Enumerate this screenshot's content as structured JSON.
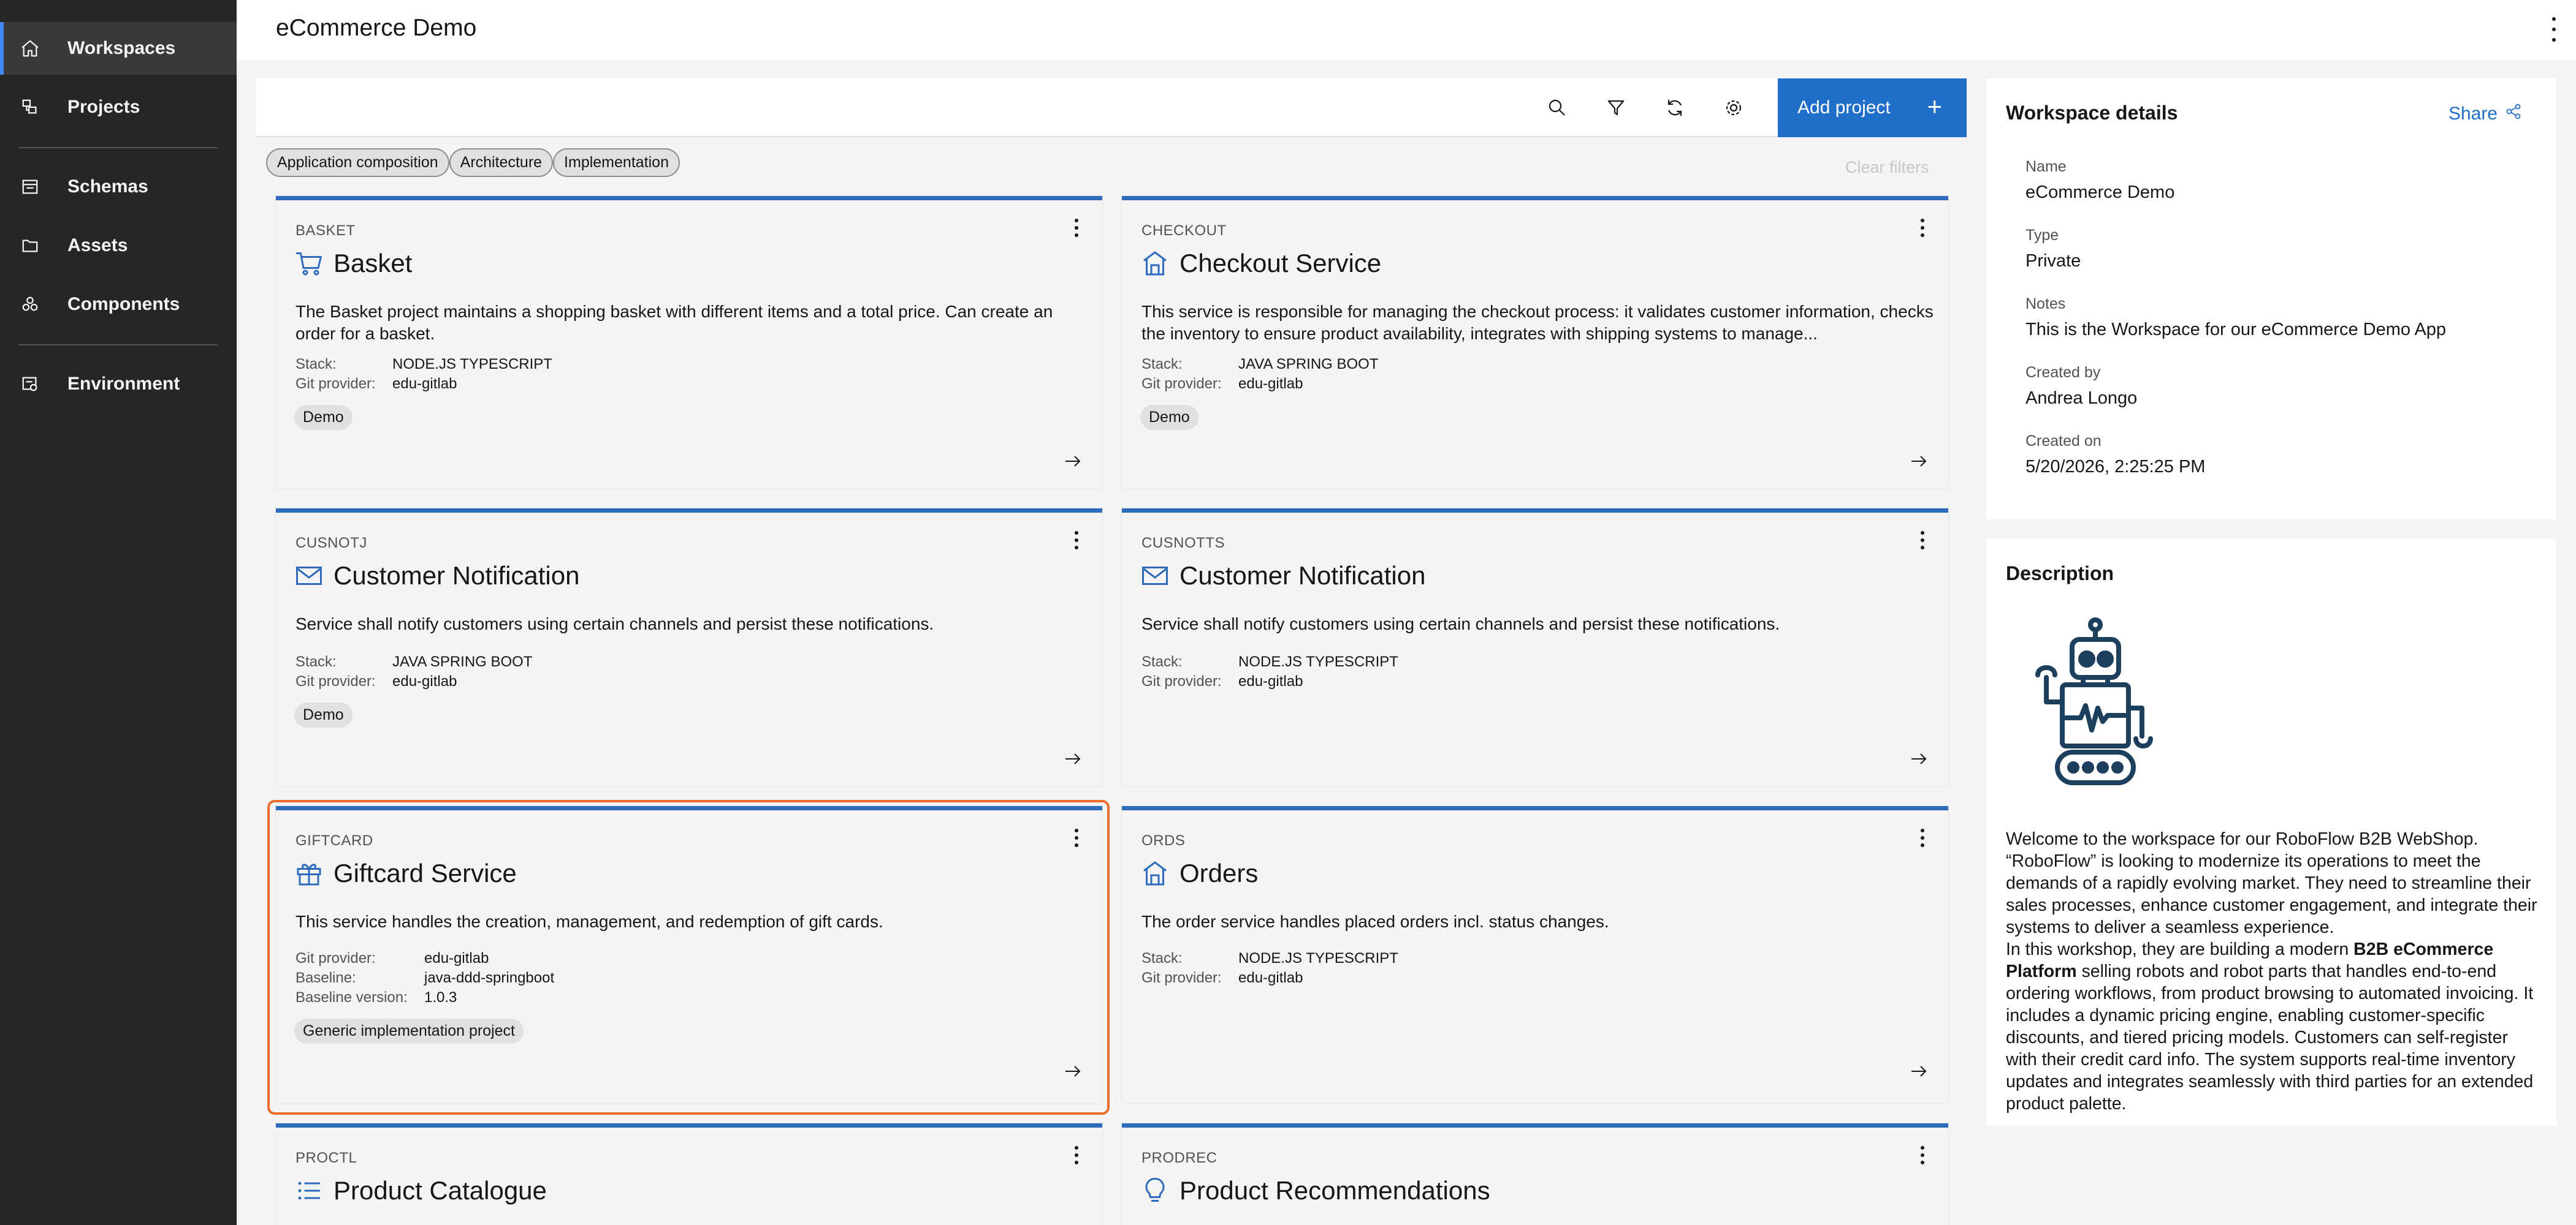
{
  "sidebar": {
    "items": [
      {
        "label": "Workspaces",
        "icon": "home-icon"
      },
      {
        "label": "Projects",
        "icon": "projects-icon"
      },
      {
        "label": "Schemas",
        "icon": "schema-icon"
      },
      {
        "label": "Assets",
        "icon": "folder-icon"
      },
      {
        "label": "Components",
        "icon": "components-icon"
      },
      {
        "label": "Environment",
        "icon": "environment-icon"
      }
    ]
  },
  "header": {
    "title": "eCommerce Demo"
  },
  "toolbar": {
    "add_project_label": "Add project",
    "plus": "+"
  },
  "filters": {
    "tags": [
      "Application composition",
      "Architecture",
      "Implementation"
    ],
    "clear_label": "Clear filters"
  },
  "labels": {
    "stack": "Stack:",
    "git_provider": "Git provider:",
    "baseline": "Baseline:",
    "baseline_version": "Baseline version:"
  },
  "cards": [
    {
      "key": "BASKET",
      "title": "Basket",
      "icon": "cart-icon",
      "description": "The Basket project maintains a shopping basket with different items and a total price. Can create an order for a basket.",
      "stack": "NODE.JS TYPESCRIPT",
      "git_provider": "edu-gitlab",
      "tag": "Demo"
    },
    {
      "key": "CHECKOUT",
      "title": "Checkout Service",
      "icon": "storefront-icon",
      "description": "This service is responsible for managing the checkout process: it validates customer information, checks the inventory to ensure product availability, integrates with shipping systems to manage...",
      "stack": "JAVA SPRING BOOT",
      "git_provider": "edu-gitlab",
      "tag": "Demo"
    },
    {
      "key": "CUSNOTJ",
      "title": "Customer Notification",
      "icon": "email-icon",
      "description": "Service shall notify customers using certain channels and persist these notifications.",
      "stack": "JAVA SPRING BOOT",
      "git_provider": "edu-gitlab",
      "tag": "Demo"
    },
    {
      "key": "CUSNOTTS",
      "title": "Customer Notification",
      "icon": "email-icon",
      "description": "Service shall notify customers using certain channels and persist these notifications.",
      "stack": "NODE.JS TYPESCRIPT",
      "git_provider": "edu-gitlab"
    },
    {
      "key": "GIFTCARD",
      "title": "Giftcard Service",
      "icon": "gift-icon",
      "description": "This service handles the creation, management, and redemption of gift cards.",
      "git_provider": "edu-gitlab",
      "baseline": "java-ddd-springboot",
      "baseline_version": "1.0.3",
      "tag": "Generic implementation project"
    },
    {
      "key": "ORDS",
      "title": "Orders",
      "icon": "storefront-icon",
      "description": "The order service handles placed orders incl. status changes.",
      "stack": "NODE.JS TYPESCRIPT",
      "git_provider": "edu-gitlab"
    },
    {
      "key": "PROCTL",
      "title": "Product Catalogue",
      "icon": "list-icon"
    },
    {
      "key": "PRODREC",
      "title": "Product Recommendations",
      "icon": "lightbulb-icon"
    }
  ],
  "details": {
    "title": "Workspace details",
    "share_label": "Share",
    "fields": [
      {
        "label": "Name",
        "value": "eCommerce Demo"
      },
      {
        "label": "Type",
        "value": "Private"
      },
      {
        "label": "Notes",
        "value": "This is the Workspace for our eCommerce Demo App"
      },
      {
        "label": "Created by",
        "value": "Andrea Longo"
      },
      {
        "label": "Created on",
        "value": "5/20/2026, 2:25:25 PM"
      }
    ]
  },
  "description": {
    "title": "Description",
    "p1": "Welcome to the workspace for our RoboFlow B2B WebShop. “RoboFlow” is looking to modernize its operations to meet the demands of a rapidly evolving market. They need to streamline their sales processes, enhance customer engagement, and integrate their systems to deliver a seamless experience.",
    "p2_pre": "In this workshop, they are building a modern ",
    "p2_bold": "B2B eCommerce Platform",
    "p2_post": " selling robots and robot parts that handles end-to-end ordering workflows, from product browsing to automated invoicing. It includes a dynamic pricing engine, enabling customer-specific discounts, and tiered pricing models. Customers can self-register with their credit card info. The system supports real-time inventory updates and integrates seamlessly with third parties for an extended product palette."
  },
  "colors": {
    "accent": "#1f6ec9",
    "sidebar": "#262626",
    "selected": "#eb6d2e",
    "card_border": "#2e6bbd"
  }
}
